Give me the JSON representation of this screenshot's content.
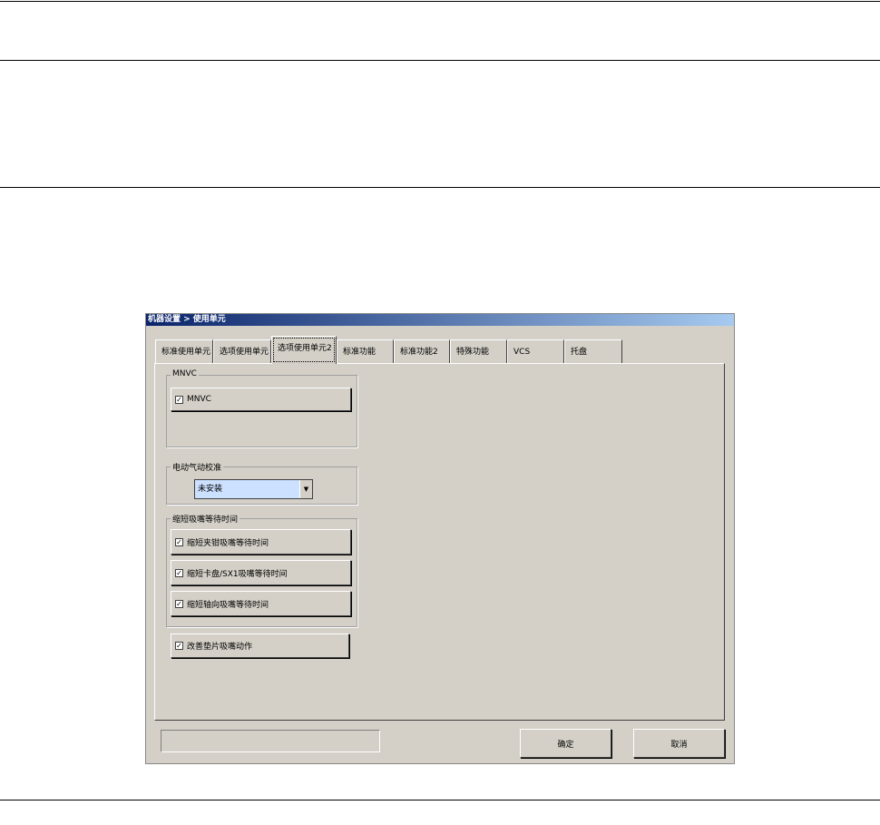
{
  "dialog": {
    "title": "机器设置 > 使用单元"
  },
  "tabs": [
    "标准使用单元",
    "选项使用单元",
    "选项使用单元2",
    "标准功能",
    "标准功能2",
    "特殊功能",
    "VCS",
    "托盘"
  ],
  "groups": {
    "mnvc": {
      "label": "MNVC",
      "checkbox": "MNVC",
      "checked": true
    },
    "calib": {
      "label": "电动气动校准",
      "select_value": "未安装"
    },
    "wait": {
      "label": "缩短吸嘴等待时间",
      "items": [
        {
          "label": "缩短夹钳吸嘴等待时间",
          "checked": true
        },
        {
          "label": "缩短卡盘/SX1吸嘴等待时间",
          "checked": true
        },
        {
          "label": "缩短轴向吸嘴等待时间",
          "checked": true
        }
      ]
    }
  },
  "pad": {
    "label": "改善垫片吸嘴动作",
    "checked": true
  },
  "buttons": {
    "ok": "确定",
    "cancel": "取消"
  },
  "check_glyph": "✓"
}
